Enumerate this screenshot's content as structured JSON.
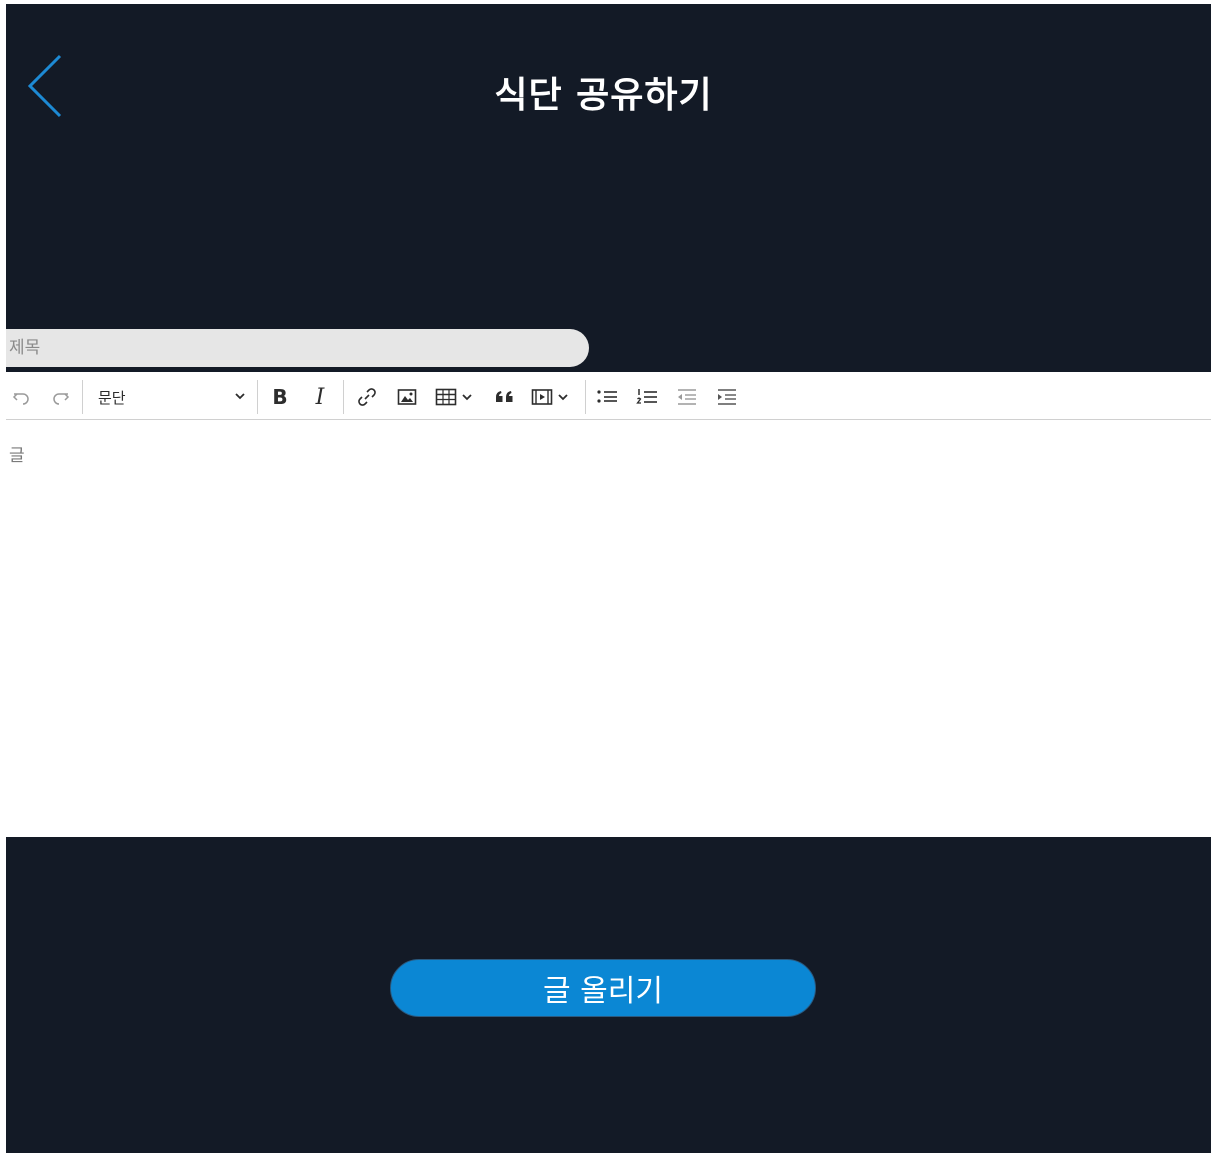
{
  "header": {
    "title": "식단 공유하기"
  },
  "form": {
    "title_placeholder": "제목",
    "content_placeholder": "글",
    "submit_label": "글 올리기"
  },
  "toolbar": {
    "paragraph_select_value": "문단",
    "bold_glyph": "B",
    "italic_glyph": "I"
  },
  "colors": {
    "background": "#131a26",
    "accent": "#0b87d4",
    "back_icon": "#1d8ad4"
  },
  "icons": [
    "back-chevron-icon",
    "undo-icon",
    "redo-icon",
    "chevron-down-icon",
    "link-icon",
    "image-icon",
    "table-icon",
    "quote-icon",
    "media-icon",
    "bulleted-list-icon",
    "numbered-list-icon",
    "outdent-icon",
    "indent-icon"
  ]
}
